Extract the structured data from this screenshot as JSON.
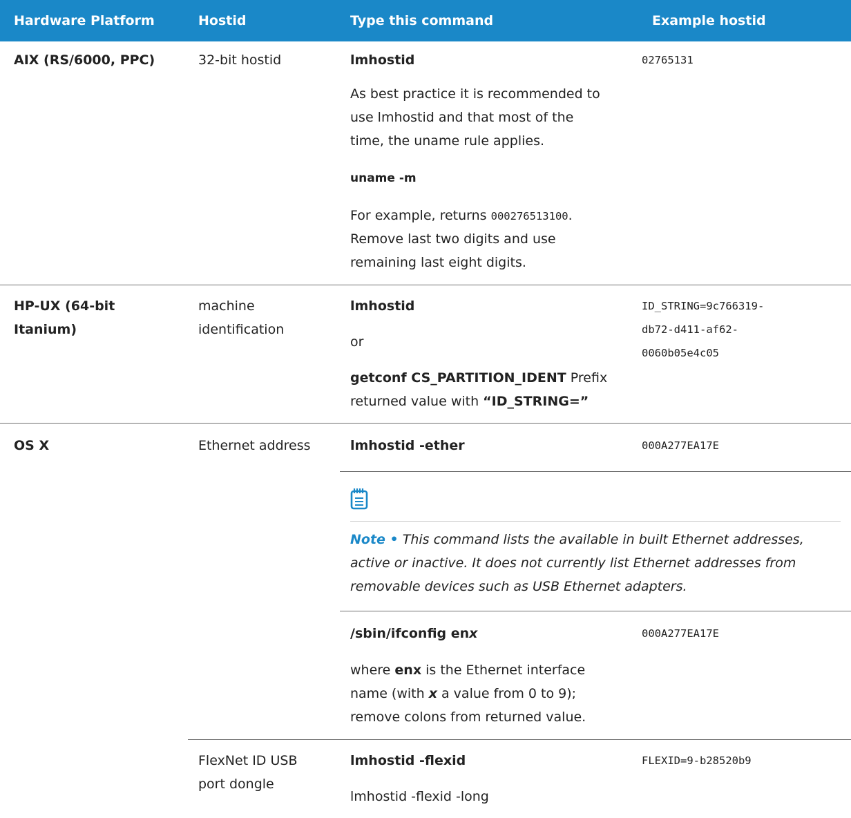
{
  "header": {
    "col1": "Hardware Platform",
    "col2": "Hostid",
    "col3": "Type this command",
    "col4": "Example hostid"
  },
  "aix": {
    "platform": "AIX (RS/6000, PPC)",
    "hostid": "32-bit hostid",
    "command": "lmhostid",
    "desc1": "As best practice it is recommended to",
    "desc2": "use lmhostid and that most of the",
    "desc3": "time, the uname rule applies.",
    "command2": "uname -m",
    "ex_pre": "For example, returns ",
    "ex_code": "000276513100",
    "ex_post": ".",
    "ex2": "Remove last two digits and use",
    "ex3": "remaining last eight digits.",
    "example": "02765131"
  },
  "hpux": {
    "platform1": "HP-UX (64-bit",
    "platform2": "Itanium)",
    "hostid1": "machine",
    "hostid2": "identification",
    "command": "lmhostid",
    "or": "or",
    "cmd_a": "getconf CS_PARTITION_IDENT",
    "cmd_b": " Prefix",
    "line_pre": "returned value with ",
    "line_bold": "“ID_STRING=”",
    "ex1": "ID_STRING=9c766319-",
    "ex2": "db72-d411-af62-",
    "ex3": "0060b05e4c05"
  },
  "osx": {
    "platform": "OS X",
    "hostid": "Ethernet address",
    "command": "lmhostid -ether",
    "example": "000A277EA17E",
    "note_label": "Note •",
    "note1": " This command lists the available in built Ethernet addresses,",
    "note2": "active or inactive. It does not currently list Ethernet addresses from",
    "note3": "removable devices such as USB Ethernet adapters.",
    "cmd2_a": "/sbin/ifconfig en",
    "cmd2_b": "x",
    "example2": "000A277EA17E",
    "w_pre": "where ",
    "w_bold": "enx",
    "w_post": " is the Ethernet interface",
    "w2_pre": "name (with ",
    "w2_bold": "x",
    "w2_post": " a value from 0 to 9);",
    "w3": "remove colons from returned value."
  },
  "flexid": {
    "hostid1": "FlexNet ID USB",
    "hostid2": "port dongle",
    "command": "lmhostid -flexid",
    "command2": "lmhostid -flexid -long",
    "example": "FLEXID=9-b28520b9"
  }
}
